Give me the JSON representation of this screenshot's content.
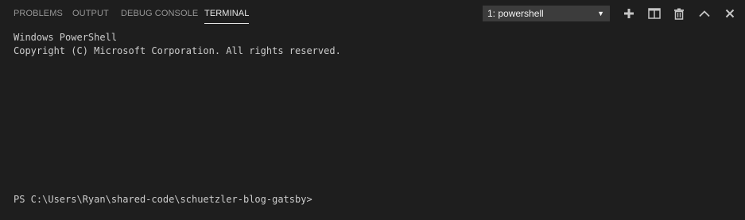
{
  "tabs": [
    {
      "label": "PROBLEMS",
      "active": false
    },
    {
      "label": "OUTPUT",
      "active": false
    },
    {
      "label": "DEBUG CONSOLE",
      "active": false
    },
    {
      "label": "TERMINAL",
      "active": true
    }
  ],
  "terminal_select": {
    "selected": "1: powershell",
    "caret": "▼"
  },
  "actions": [
    {
      "icon": "plus-icon",
      "name": "new-terminal"
    },
    {
      "icon": "split-icon",
      "name": "split-terminal"
    },
    {
      "icon": "trash-icon",
      "name": "kill-terminal"
    },
    {
      "icon": "chevron-up-icon",
      "name": "maximize-panel"
    },
    {
      "icon": "close-icon",
      "name": "close-panel"
    }
  ],
  "terminal": {
    "lines": [
      "Windows PowerShell",
      "Copyright (C) Microsoft Corporation. All rights reserved."
    ],
    "prompt": "PS C:\\Users\\Ryan\\shared-code\\schuetzler-blog-gatsby>"
  },
  "colors": {
    "background": "#1e1e1e",
    "tab_inactive": "#969696",
    "tab_active": "#e7e7e7",
    "select_bg": "#3c3c3c",
    "terminal_text": "#cccccc",
    "icon": "#c5c5c5"
  }
}
